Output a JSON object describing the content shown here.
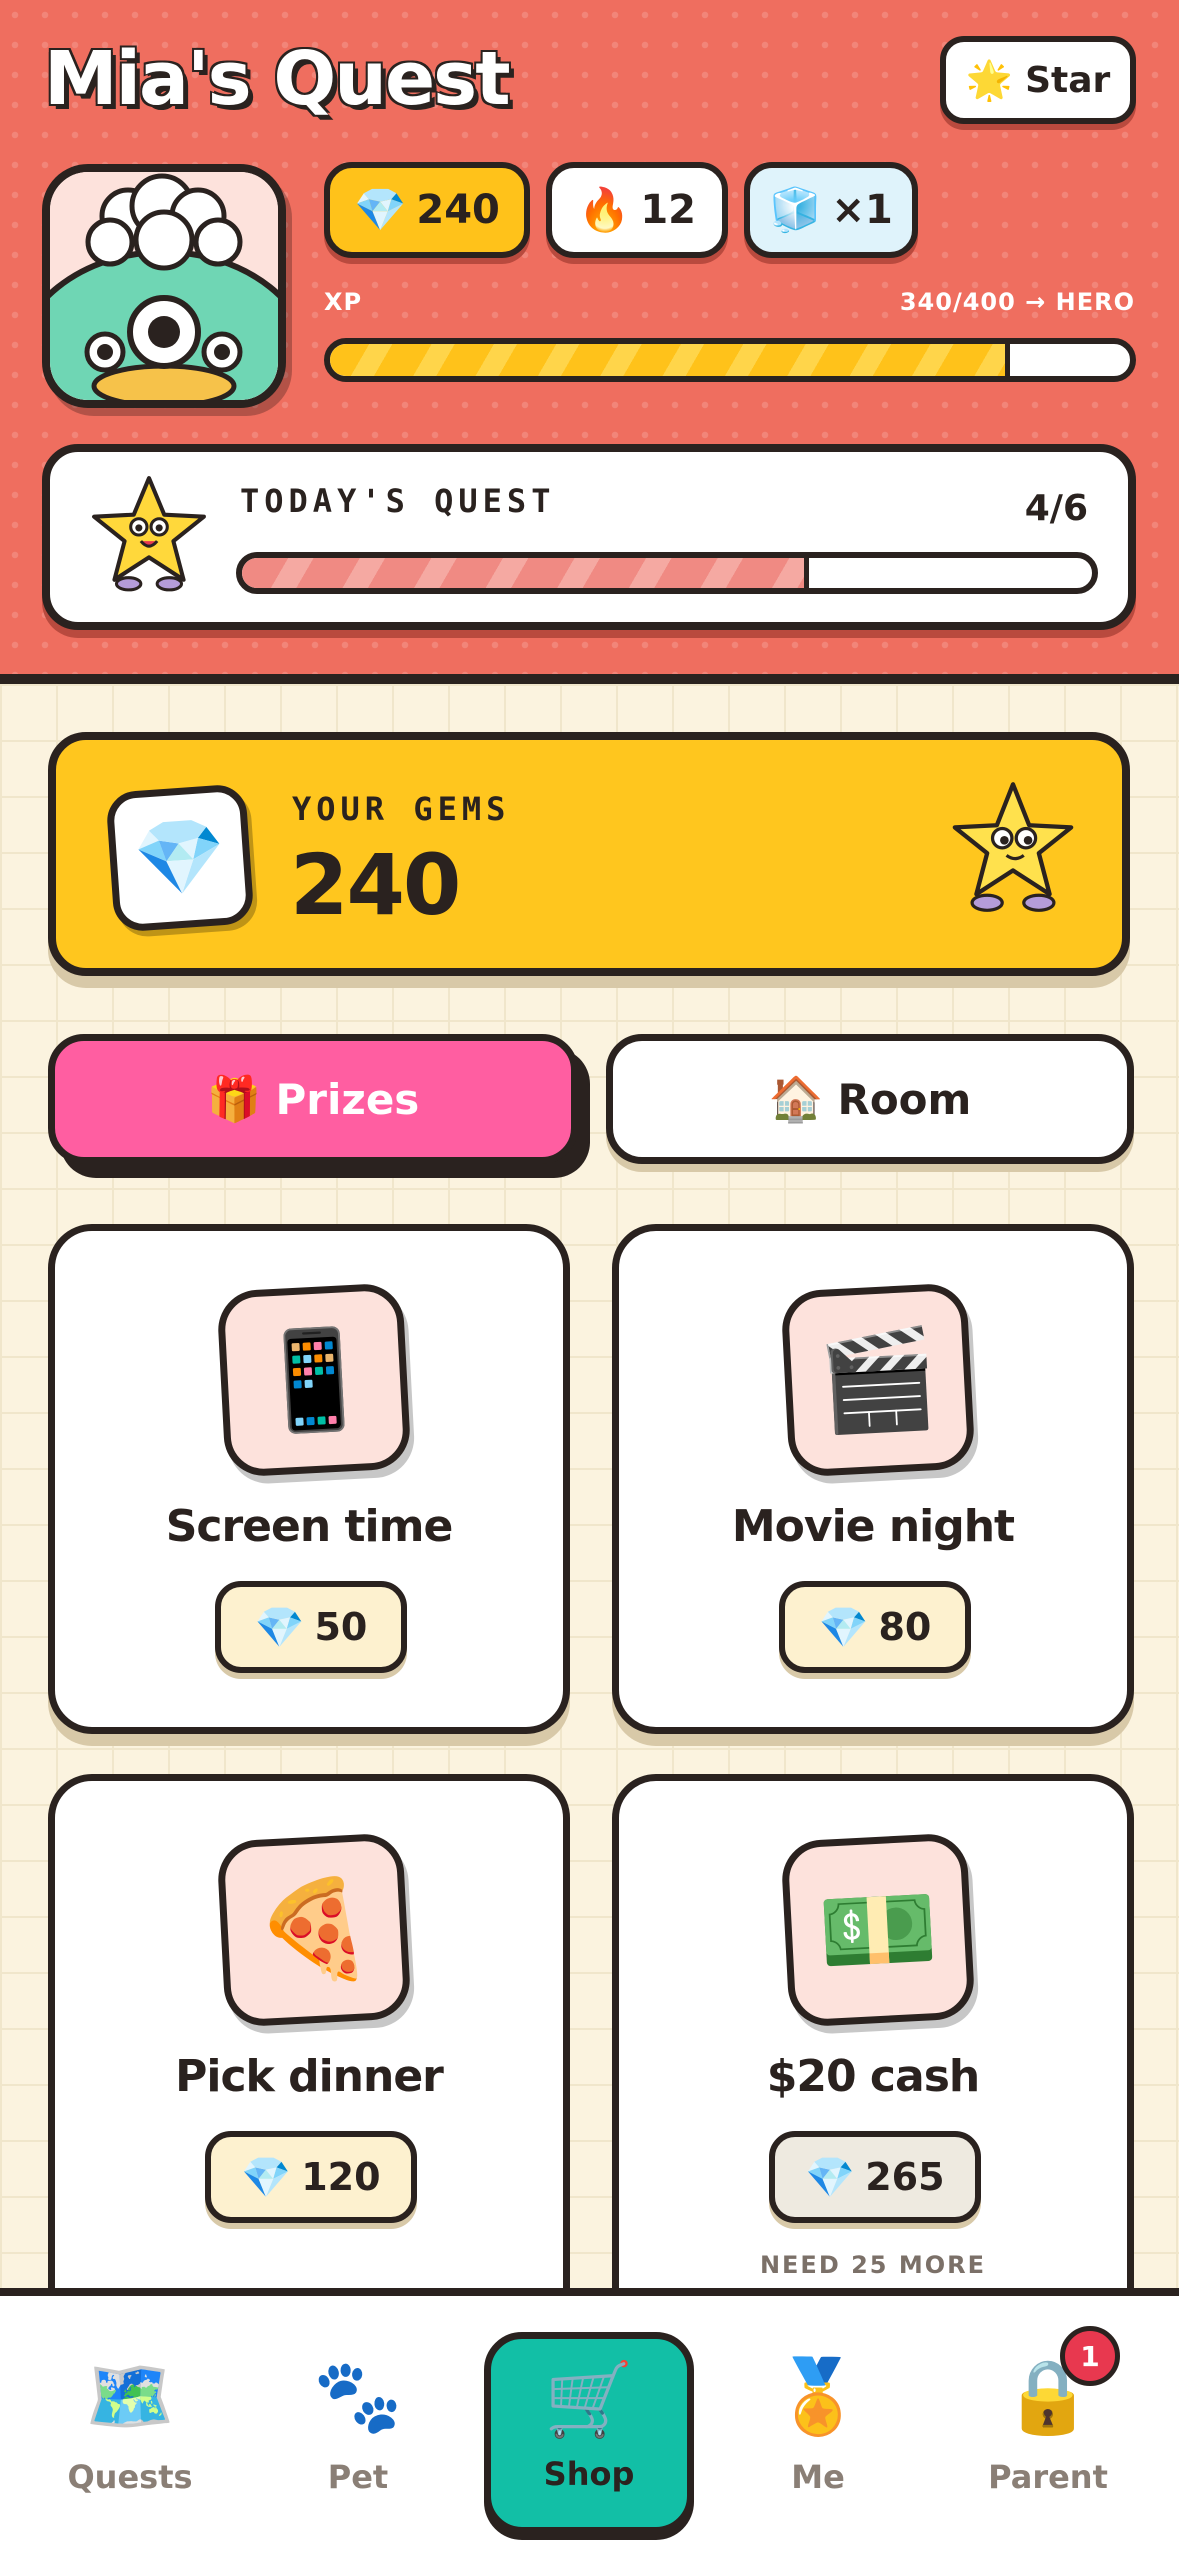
{
  "header": {
    "title": "Mia's Quest",
    "star_button": {
      "icon": "sun-star-icon",
      "label": "Star"
    },
    "stats": {
      "gems": {
        "icon": "gem-icon",
        "value": "240"
      },
      "streak": {
        "icon": "fire-icon",
        "value": "12"
      },
      "freeze": {
        "icon": "ice-cube-icon",
        "value": "×1"
      }
    },
    "xp": {
      "label": "XP",
      "value": "340/400 → HERO",
      "progress": 0.85
    },
    "quest": {
      "label": "TODAY'S QUEST",
      "count": "4/6",
      "progress": 0.667
    }
  },
  "gems_card": {
    "label": "YOUR GEMS",
    "value": "240"
  },
  "tabs": [
    {
      "icon": "gift-icon",
      "label": "Prizes",
      "active": true
    },
    {
      "icon": "house-icon",
      "label": "Room",
      "active": false
    }
  ],
  "prizes": [
    {
      "icon": "phone-icon",
      "name": "Screen time",
      "price": "50",
      "note": ""
    },
    {
      "icon": "clapperboard-icon",
      "name": "Movie night",
      "price": "80",
      "note": ""
    },
    {
      "icon": "pizza-icon",
      "name": "Pick dinner",
      "price": "120",
      "note": ""
    },
    {
      "icon": "cash-icon",
      "name": "$20 cash",
      "price": "265",
      "note": "NEED 25 MORE"
    }
  ],
  "nav": [
    {
      "icon": "map-icon",
      "label": "Quests",
      "active": false
    },
    {
      "icon": "paw-icon",
      "label": "Pet",
      "active": false
    },
    {
      "icon": "cart-icon",
      "label": "Shop",
      "active": true
    },
    {
      "icon": "medal-icon",
      "label": "Me",
      "active": false
    },
    {
      "icon": "lock-icon",
      "label": "Parent",
      "active": false,
      "badge": "1"
    }
  ],
  "colors": {
    "header_bg": "#ef6e5f",
    "gems_yellow": "#ffc61e",
    "prizes_pink": "#ff5ea1",
    "shop_teal": "#12bfa6",
    "badge_red": "#e8384f"
  }
}
